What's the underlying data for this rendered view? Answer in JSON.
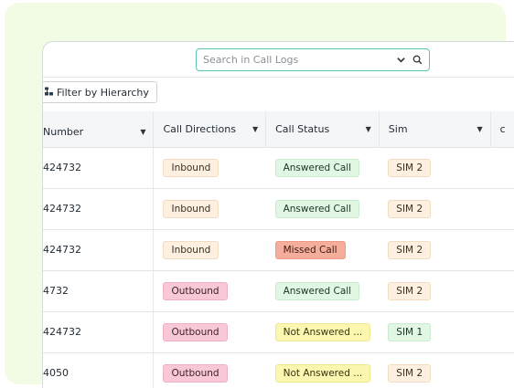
{
  "search": {
    "placeholder": "Search in Call Logs"
  },
  "toolbar": {
    "filter_label": "Filter by Hierarchy"
  },
  "table": {
    "columns": [
      "Number",
      "Call Directions",
      "Call Status",
      "Sim"
    ],
    "rows": [
      {
        "number": "424732",
        "direction": "Inbound",
        "status": "Answered Call",
        "sim": "SIM 2"
      },
      {
        "number": "424732",
        "direction": "Inbound",
        "status": "Answered Call",
        "sim": "SIM 2"
      },
      {
        "number": "424732",
        "direction": "Inbound",
        "status": "Missed Call",
        "sim": "SIM 2"
      },
      {
        "number": "4732",
        "direction": "Outbound",
        "status": "Answered Call",
        "sim": "SIM 2"
      },
      {
        "number": "424732",
        "direction": "Outbound",
        "status": "Not Answered ...",
        "sim": "SIM 1"
      },
      {
        "number": "4050",
        "direction": "Outbound",
        "status": "Not Answered ...",
        "sim": "SIM 2"
      }
    ]
  },
  "colors": {
    "search_border": "#55c7b4",
    "backdrop": "#f2fbe3",
    "inbound": "#fdf0e1",
    "outbound": "#f9c8d6",
    "answered": "#e2f6e4",
    "missed": "#f6ae9c",
    "not_answered": "#fbf6b0"
  }
}
